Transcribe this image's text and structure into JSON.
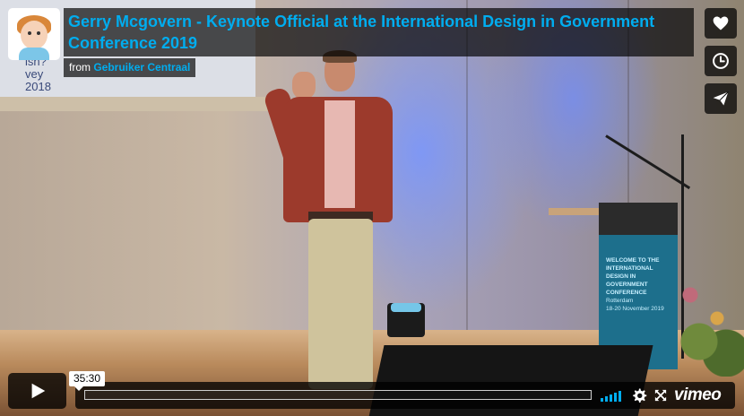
{
  "video": {
    "title": "Gerry Mcgovern - Keynote Official at the International Design in Government Conference 2019",
    "byline_prefix": "from",
    "author": "Gebruiker Centraal"
  },
  "scene": {
    "screen_text": [
      "ish?",
      "vey",
      "2018"
    ],
    "podium_text": [
      "WELCOME TO THE",
      "INTERNATIONAL",
      "DESIGN IN GOVERNMENT",
      "CONFERENCE",
      "Rotterdam",
      "18-20 November 2019"
    ]
  },
  "sidebar": [
    {
      "name": "like-button",
      "icon": "heart-icon",
      "label": "Like"
    },
    {
      "name": "watch-later-button",
      "icon": "clock-icon",
      "label": "Watch Later"
    },
    {
      "name": "share-button",
      "icon": "paper-plane-icon",
      "label": "Share"
    }
  ],
  "controls": {
    "play_icon": "play-icon",
    "time_tooltip": "35:30",
    "progress": 0.0,
    "volume_icon": "volume-icon",
    "settings_icon": "gear-icon",
    "fullscreen_icon": "fullscreen-icon",
    "logo": "vimeo"
  },
  "colors": {
    "accent": "#00adef",
    "overlay": "#000000",
    "text": "#ffffff"
  }
}
